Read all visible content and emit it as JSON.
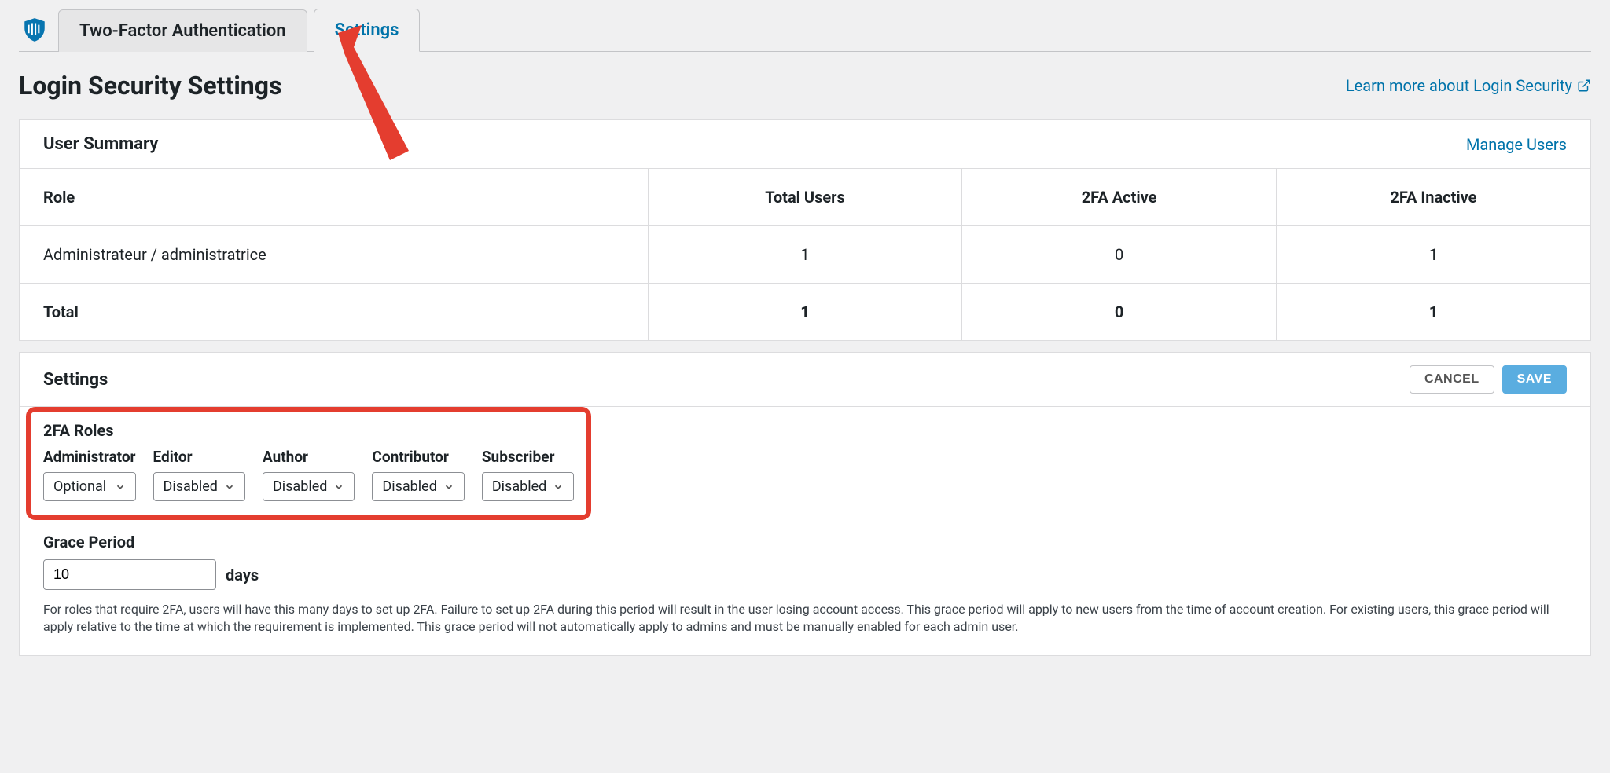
{
  "tabs": {
    "tfa": "Two-Factor Authentication",
    "settings": "Settings"
  },
  "page_title": "Login Security Settings",
  "learn_more": "Learn more about Login Security",
  "user_summary": {
    "heading": "User Summary",
    "manage": "Manage Users",
    "columns": {
      "role": "Role",
      "total": "Total Users",
      "active": "2FA Active",
      "inactive": "2FA Inactive"
    },
    "rows": [
      {
        "role": "Administrateur / administratrice",
        "total": "1",
        "active": "0",
        "inactive": "1"
      }
    ],
    "total_row": {
      "label": "Total",
      "total": "1",
      "active": "0",
      "inactive": "1"
    }
  },
  "settings_panel": {
    "heading": "Settings",
    "cancel": "CANCEL",
    "save": "SAVE",
    "tfa_roles_heading": "2FA Roles",
    "roles": {
      "administrator": {
        "label": "Administrator",
        "value": "Optional"
      },
      "editor": {
        "label": "Editor",
        "value": "Disabled"
      },
      "author": {
        "label": "Author",
        "value": "Disabled"
      },
      "contributor": {
        "label": "Contributor",
        "value": "Disabled"
      },
      "subscriber": {
        "label": "Subscriber",
        "value": "Disabled"
      }
    },
    "grace": {
      "heading": "Grace Period",
      "value": "10",
      "unit": "days",
      "help": "For roles that require 2FA, users will have this many days to set up 2FA. Failure to set up 2FA during this period will result in the user losing account access. This grace period will apply to new users from the time of account creation. For existing users, this grace period will apply relative to the time at which the requirement is implemented. This grace period will not automatically apply to admins and must be manually enabled for each admin user."
    }
  }
}
